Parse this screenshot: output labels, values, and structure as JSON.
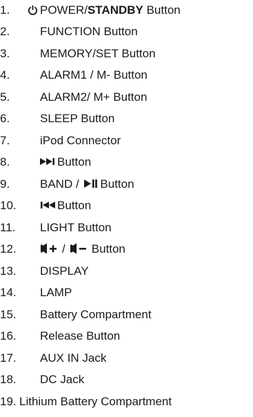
{
  "items": [
    {
      "num": "1.",
      "icon": "power-icon",
      "text": "POWER/",
      "bold": "STANDBY",
      "after": " Button"
    },
    {
      "num": "2.",
      "text": "FUNCTION Button"
    },
    {
      "num": "3.",
      "text": "MEMORY/SET Button"
    },
    {
      "num": "4.",
      "text": "ALARM1 / M- Button"
    },
    {
      "num": "5.",
      "text": "ALARM2/ M+ Button"
    },
    {
      "num": "6.",
      "text": "SLEEP Button"
    },
    {
      "num": "7.",
      "text": "iPod Connector"
    },
    {
      "num": "8.",
      "icon": "skip-forward-icon",
      "text": "Button"
    },
    {
      "num": "9.",
      "text": "BAND / ",
      "icon": "play-pause-icon",
      "after": "Button"
    },
    {
      "num": "10.",
      "icon": "skip-back-icon",
      "text": "Button"
    },
    {
      "num": "11.",
      "text": "LIGHT Button"
    },
    {
      "num": "12.",
      "icon": "volume-up-icon",
      "mid": "/",
      "icon2": "volume-down-icon",
      "text": "Button"
    },
    {
      "num": "13.",
      "text": "DISPLAY"
    },
    {
      "num": "14.",
      "text": "LAMP"
    },
    {
      "num": "15.",
      "text": "Battery Compartment"
    },
    {
      "num": "16.",
      "text": "Release Button"
    },
    {
      "num": "17.",
      "text": "AUX IN Jack"
    },
    {
      "num": "18.",
      "text": "DC Jack"
    },
    {
      "num": "19.",
      "text": "Lithium Battery Compartment"
    }
  ]
}
